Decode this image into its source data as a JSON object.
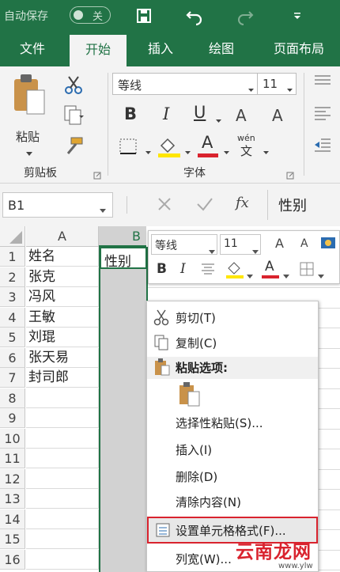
{
  "titlebar": {
    "autosave_label": "自动保存",
    "toggle_state": "关"
  },
  "tabs": [
    "文件",
    "开始",
    "插入",
    "绘图",
    "页面布局"
  ],
  "ribbon": {
    "paste_label": "粘贴",
    "clipboard_group": "剪贴板",
    "font_name": "等线",
    "font_size": "11",
    "bold": "B",
    "italic": "I",
    "underline": "U",
    "grow_font": "A",
    "shrink_font": "A",
    "font_color_letter": "A",
    "wen_top": "wén",
    "wen_bottom": "文",
    "font_group": "字体"
  },
  "formula_bar": {
    "name_box": "B1",
    "fx": "fx",
    "content": "性别"
  },
  "grid": {
    "col_a": "A",
    "col_b": "B",
    "rows": [
      "1",
      "2",
      "3",
      "4",
      "5",
      "6",
      "7",
      "8",
      "9",
      "10",
      "11",
      "12",
      "13",
      "14",
      "15",
      "16"
    ],
    "col_a_values": [
      "姓名",
      "张克",
      "冯风",
      "王敏",
      "刘琨",
      "张天易",
      "封司郎"
    ],
    "b1_value": "性别"
  },
  "mini_toolbar": {
    "font_name": "等线",
    "font_size": "11",
    "bold": "B",
    "italic": "I",
    "grow": "A",
    "shrink": "A",
    "color_letter": "A"
  },
  "context_menu": {
    "cut": "剪切(T)",
    "copy": "复制(C)",
    "paste_options": "粘贴选项:",
    "paste_special": "选择性粘贴(S)...",
    "insert": "插入(I)",
    "delete": "删除(D)",
    "clear": "清除内容(N)",
    "format_cells": "设置单元格格式(F)...",
    "column_width": "列宽(W)..."
  },
  "watermark": {
    "text": "云南龙网",
    "sub": "www.ylw"
  },
  "colors": {
    "excel_green": "#217346",
    "highlight_yellow": "#ffe600",
    "font_red": "#d9232e",
    "selection_border": "#d9232e"
  }
}
